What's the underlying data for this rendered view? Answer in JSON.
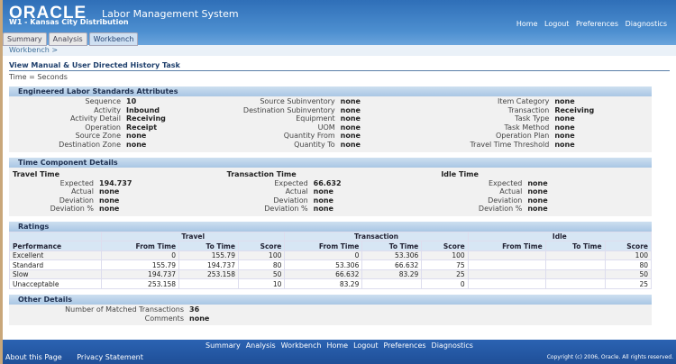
{
  "header": {
    "logo": "ORACLE",
    "app_title": "Labor Management System",
    "org": "W1 - Kansas City Distribution",
    "global_links": [
      "Home",
      "Logout",
      "Preferences",
      "Diagnostics"
    ]
  },
  "tabs": [
    {
      "label": "Summary"
    },
    {
      "label": "Analysis"
    },
    {
      "label": "Workbench",
      "active": true
    }
  ],
  "breadcrumb": "Workbench  >",
  "page_title": "View Manual & User Directed History Task",
  "note": "Time = Seconds",
  "attributes": {
    "title": "Engineered Labor Standards Attributes",
    "columns": [
      [
        {
          "k": "Sequence",
          "v": "10"
        },
        {
          "k": "Activity",
          "v": "Inbound"
        },
        {
          "k": "Activity Detail",
          "v": "Receiving"
        },
        {
          "k": "Operation",
          "v": "Receipt"
        },
        {
          "k": "Source Zone",
          "v": "none"
        },
        {
          "k": "Destination Zone",
          "v": "none"
        }
      ],
      [
        {
          "k": "Source Subinventory",
          "v": "none"
        },
        {
          "k": "Destination Subinventory",
          "v": "none"
        },
        {
          "k": "Equipment",
          "v": "none"
        },
        {
          "k": "UOM",
          "v": "none"
        },
        {
          "k": "Quantity From",
          "v": "none"
        },
        {
          "k": "Quantity To",
          "v": "none"
        }
      ],
      [
        {
          "k": "Item Category",
          "v": "none"
        },
        {
          "k": "Transaction",
          "v": "Receiving"
        },
        {
          "k": "Task Type",
          "v": "none"
        },
        {
          "k": "Task Method",
          "v": "none"
        },
        {
          "k": "Operation Plan",
          "v": "none"
        },
        {
          "k": "Travel Time Threshold",
          "v": "none"
        }
      ]
    ]
  },
  "time_components": {
    "title": "Time Component Details",
    "groups": [
      {
        "name": "Travel Time",
        "rows": [
          {
            "k": "Expected",
            "v": "194.737"
          },
          {
            "k": "Actual",
            "v": "none"
          },
          {
            "k": "Deviation",
            "v": "none"
          },
          {
            "k": "Deviation %",
            "v": "none"
          }
        ]
      },
      {
        "name": "Transaction Time",
        "rows": [
          {
            "k": "Expected",
            "v": "66.632"
          },
          {
            "k": "Actual",
            "v": "none"
          },
          {
            "k": "Deviation",
            "v": "none"
          },
          {
            "k": "Deviation %",
            "v": "none"
          }
        ]
      },
      {
        "name": "Idle Time",
        "rows": [
          {
            "k": "Expected",
            "v": "none"
          },
          {
            "k": "Actual",
            "v": "none"
          },
          {
            "k": "Deviation",
            "v": "none"
          },
          {
            "k": "Deviation %",
            "v": "none"
          }
        ]
      }
    ]
  },
  "ratings": {
    "title": "Ratings",
    "groups": [
      "Travel",
      "Transaction",
      "Idle"
    ],
    "perf_header": "Performance",
    "sub_headers": [
      "From Time",
      "To Time",
      "Score"
    ],
    "rows": [
      [
        "Excellent",
        "0",
        "155.79",
        "100",
        "0",
        "53.306",
        "100",
        "",
        "",
        "100"
      ],
      [
        "Standard",
        "155.79",
        "194.737",
        "80",
        "53.306",
        "66.632",
        "75",
        "",
        "",
        "80"
      ],
      [
        "Slow",
        "194.737",
        "253.158",
        "50",
        "66.632",
        "83.29",
        "25",
        "",
        "",
        "50"
      ],
      [
        "Unacceptable",
        "253.158",
        "",
        "10",
        "83.29",
        "",
        "0",
        "",
        "",
        "25"
      ]
    ]
  },
  "other": {
    "title": "Other Details",
    "rows": [
      {
        "k": "Number of Matched Transactions",
        "v": "36"
      },
      {
        "k": "Comments",
        "v": "none"
      }
    ]
  },
  "footer": {
    "links": [
      "Summary",
      "Analysis",
      "Workbench",
      "Home",
      "Logout",
      "Preferences",
      "Diagnostics"
    ],
    "about": "About this Page",
    "privacy": "Privacy Statement",
    "copyright": "Copyright (c) 2006, Oracle. All rights reserved."
  }
}
